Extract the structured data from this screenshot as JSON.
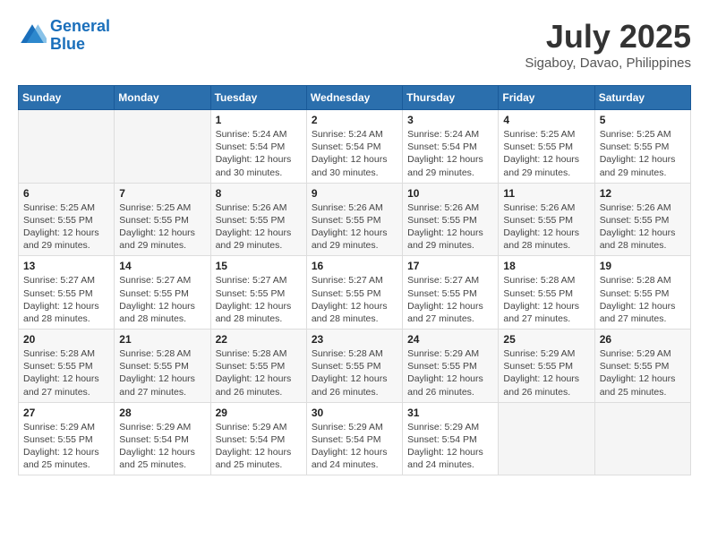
{
  "header": {
    "logo_line1": "General",
    "logo_line2": "Blue",
    "month_year": "July 2025",
    "location": "Sigaboy, Davao, Philippines"
  },
  "weekdays": [
    "Sunday",
    "Monday",
    "Tuesday",
    "Wednesday",
    "Thursday",
    "Friday",
    "Saturday"
  ],
  "weeks": [
    [
      {
        "day": "",
        "info": ""
      },
      {
        "day": "",
        "info": ""
      },
      {
        "day": "1",
        "info": "Sunrise: 5:24 AM\nSunset: 5:54 PM\nDaylight: 12 hours\nand 30 minutes."
      },
      {
        "day": "2",
        "info": "Sunrise: 5:24 AM\nSunset: 5:54 PM\nDaylight: 12 hours\nand 30 minutes."
      },
      {
        "day": "3",
        "info": "Sunrise: 5:24 AM\nSunset: 5:54 PM\nDaylight: 12 hours\nand 29 minutes."
      },
      {
        "day": "4",
        "info": "Sunrise: 5:25 AM\nSunset: 5:55 PM\nDaylight: 12 hours\nand 29 minutes."
      },
      {
        "day": "5",
        "info": "Sunrise: 5:25 AM\nSunset: 5:55 PM\nDaylight: 12 hours\nand 29 minutes."
      }
    ],
    [
      {
        "day": "6",
        "info": "Sunrise: 5:25 AM\nSunset: 5:55 PM\nDaylight: 12 hours\nand 29 minutes."
      },
      {
        "day": "7",
        "info": "Sunrise: 5:25 AM\nSunset: 5:55 PM\nDaylight: 12 hours\nand 29 minutes."
      },
      {
        "day": "8",
        "info": "Sunrise: 5:26 AM\nSunset: 5:55 PM\nDaylight: 12 hours\nand 29 minutes."
      },
      {
        "day": "9",
        "info": "Sunrise: 5:26 AM\nSunset: 5:55 PM\nDaylight: 12 hours\nand 29 minutes."
      },
      {
        "day": "10",
        "info": "Sunrise: 5:26 AM\nSunset: 5:55 PM\nDaylight: 12 hours\nand 29 minutes."
      },
      {
        "day": "11",
        "info": "Sunrise: 5:26 AM\nSunset: 5:55 PM\nDaylight: 12 hours\nand 28 minutes."
      },
      {
        "day": "12",
        "info": "Sunrise: 5:26 AM\nSunset: 5:55 PM\nDaylight: 12 hours\nand 28 minutes."
      }
    ],
    [
      {
        "day": "13",
        "info": "Sunrise: 5:27 AM\nSunset: 5:55 PM\nDaylight: 12 hours\nand 28 minutes."
      },
      {
        "day": "14",
        "info": "Sunrise: 5:27 AM\nSunset: 5:55 PM\nDaylight: 12 hours\nand 28 minutes."
      },
      {
        "day": "15",
        "info": "Sunrise: 5:27 AM\nSunset: 5:55 PM\nDaylight: 12 hours\nand 28 minutes."
      },
      {
        "day": "16",
        "info": "Sunrise: 5:27 AM\nSunset: 5:55 PM\nDaylight: 12 hours\nand 28 minutes."
      },
      {
        "day": "17",
        "info": "Sunrise: 5:27 AM\nSunset: 5:55 PM\nDaylight: 12 hours\nand 27 minutes."
      },
      {
        "day": "18",
        "info": "Sunrise: 5:28 AM\nSunset: 5:55 PM\nDaylight: 12 hours\nand 27 minutes."
      },
      {
        "day": "19",
        "info": "Sunrise: 5:28 AM\nSunset: 5:55 PM\nDaylight: 12 hours\nand 27 minutes."
      }
    ],
    [
      {
        "day": "20",
        "info": "Sunrise: 5:28 AM\nSunset: 5:55 PM\nDaylight: 12 hours\nand 27 minutes."
      },
      {
        "day": "21",
        "info": "Sunrise: 5:28 AM\nSunset: 5:55 PM\nDaylight: 12 hours\nand 27 minutes."
      },
      {
        "day": "22",
        "info": "Sunrise: 5:28 AM\nSunset: 5:55 PM\nDaylight: 12 hours\nand 26 minutes."
      },
      {
        "day": "23",
        "info": "Sunrise: 5:28 AM\nSunset: 5:55 PM\nDaylight: 12 hours\nand 26 minutes."
      },
      {
        "day": "24",
        "info": "Sunrise: 5:29 AM\nSunset: 5:55 PM\nDaylight: 12 hours\nand 26 minutes."
      },
      {
        "day": "25",
        "info": "Sunrise: 5:29 AM\nSunset: 5:55 PM\nDaylight: 12 hours\nand 26 minutes."
      },
      {
        "day": "26",
        "info": "Sunrise: 5:29 AM\nSunset: 5:55 PM\nDaylight: 12 hours\nand 25 minutes."
      }
    ],
    [
      {
        "day": "27",
        "info": "Sunrise: 5:29 AM\nSunset: 5:55 PM\nDaylight: 12 hours\nand 25 minutes."
      },
      {
        "day": "28",
        "info": "Sunrise: 5:29 AM\nSunset: 5:54 PM\nDaylight: 12 hours\nand 25 minutes."
      },
      {
        "day": "29",
        "info": "Sunrise: 5:29 AM\nSunset: 5:54 PM\nDaylight: 12 hours\nand 25 minutes."
      },
      {
        "day": "30",
        "info": "Sunrise: 5:29 AM\nSunset: 5:54 PM\nDaylight: 12 hours\nand 24 minutes."
      },
      {
        "day": "31",
        "info": "Sunrise: 5:29 AM\nSunset: 5:54 PM\nDaylight: 12 hours\nand 24 minutes."
      },
      {
        "day": "",
        "info": ""
      },
      {
        "day": "",
        "info": ""
      }
    ]
  ]
}
